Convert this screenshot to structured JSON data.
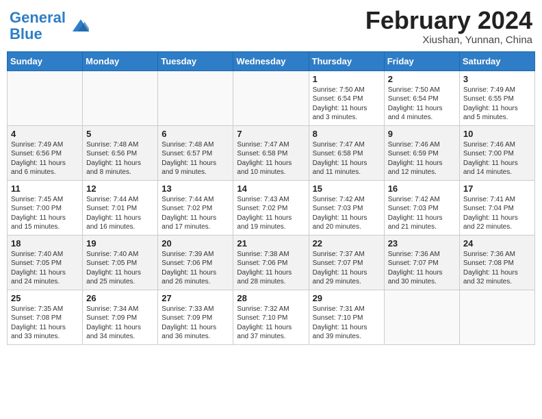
{
  "header": {
    "logo_line1": "General",
    "logo_line2": "Blue",
    "main_title": "February 2024",
    "subtitle": "Xiushan, Yunnan, China"
  },
  "days_of_week": [
    "Sunday",
    "Monday",
    "Tuesday",
    "Wednesday",
    "Thursday",
    "Friday",
    "Saturday"
  ],
  "weeks": [
    [
      {
        "day": "",
        "info": ""
      },
      {
        "day": "",
        "info": ""
      },
      {
        "day": "",
        "info": ""
      },
      {
        "day": "",
        "info": ""
      },
      {
        "day": "1",
        "info": "Sunrise: 7:50 AM\nSunset: 6:54 PM\nDaylight: 11 hours and 3 minutes."
      },
      {
        "day": "2",
        "info": "Sunrise: 7:50 AM\nSunset: 6:54 PM\nDaylight: 11 hours and 4 minutes."
      },
      {
        "day": "3",
        "info": "Sunrise: 7:49 AM\nSunset: 6:55 PM\nDaylight: 11 hours and 5 minutes."
      }
    ],
    [
      {
        "day": "4",
        "info": "Sunrise: 7:49 AM\nSunset: 6:56 PM\nDaylight: 11 hours and 6 minutes."
      },
      {
        "day": "5",
        "info": "Sunrise: 7:48 AM\nSunset: 6:56 PM\nDaylight: 11 hours and 8 minutes."
      },
      {
        "day": "6",
        "info": "Sunrise: 7:48 AM\nSunset: 6:57 PM\nDaylight: 11 hours and 9 minutes."
      },
      {
        "day": "7",
        "info": "Sunrise: 7:47 AM\nSunset: 6:58 PM\nDaylight: 11 hours and 10 minutes."
      },
      {
        "day": "8",
        "info": "Sunrise: 7:47 AM\nSunset: 6:58 PM\nDaylight: 11 hours and 11 minutes."
      },
      {
        "day": "9",
        "info": "Sunrise: 7:46 AM\nSunset: 6:59 PM\nDaylight: 11 hours and 12 minutes."
      },
      {
        "day": "10",
        "info": "Sunrise: 7:46 AM\nSunset: 7:00 PM\nDaylight: 11 hours and 14 minutes."
      }
    ],
    [
      {
        "day": "11",
        "info": "Sunrise: 7:45 AM\nSunset: 7:00 PM\nDaylight: 11 hours and 15 minutes."
      },
      {
        "day": "12",
        "info": "Sunrise: 7:44 AM\nSunset: 7:01 PM\nDaylight: 11 hours and 16 minutes."
      },
      {
        "day": "13",
        "info": "Sunrise: 7:44 AM\nSunset: 7:02 PM\nDaylight: 11 hours and 17 minutes."
      },
      {
        "day": "14",
        "info": "Sunrise: 7:43 AM\nSunset: 7:02 PM\nDaylight: 11 hours and 19 minutes."
      },
      {
        "day": "15",
        "info": "Sunrise: 7:42 AM\nSunset: 7:03 PM\nDaylight: 11 hours and 20 minutes."
      },
      {
        "day": "16",
        "info": "Sunrise: 7:42 AM\nSunset: 7:03 PM\nDaylight: 11 hours and 21 minutes."
      },
      {
        "day": "17",
        "info": "Sunrise: 7:41 AM\nSunset: 7:04 PM\nDaylight: 11 hours and 22 minutes."
      }
    ],
    [
      {
        "day": "18",
        "info": "Sunrise: 7:40 AM\nSunset: 7:05 PM\nDaylight: 11 hours and 24 minutes."
      },
      {
        "day": "19",
        "info": "Sunrise: 7:40 AM\nSunset: 7:05 PM\nDaylight: 11 hours and 25 minutes."
      },
      {
        "day": "20",
        "info": "Sunrise: 7:39 AM\nSunset: 7:06 PM\nDaylight: 11 hours and 26 minutes."
      },
      {
        "day": "21",
        "info": "Sunrise: 7:38 AM\nSunset: 7:06 PM\nDaylight: 11 hours and 28 minutes."
      },
      {
        "day": "22",
        "info": "Sunrise: 7:37 AM\nSunset: 7:07 PM\nDaylight: 11 hours and 29 minutes."
      },
      {
        "day": "23",
        "info": "Sunrise: 7:36 AM\nSunset: 7:07 PM\nDaylight: 11 hours and 30 minutes."
      },
      {
        "day": "24",
        "info": "Sunrise: 7:36 AM\nSunset: 7:08 PM\nDaylight: 11 hours and 32 minutes."
      }
    ],
    [
      {
        "day": "25",
        "info": "Sunrise: 7:35 AM\nSunset: 7:08 PM\nDaylight: 11 hours and 33 minutes."
      },
      {
        "day": "26",
        "info": "Sunrise: 7:34 AM\nSunset: 7:09 PM\nDaylight: 11 hours and 34 minutes."
      },
      {
        "day": "27",
        "info": "Sunrise: 7:33 AM\nSunset: 7:09 PM\nDaylight: 11 hours and 36 minutes."
      },
      {
        "day": "28",
        "info": "Sunrise: 7:32 AM\nSunset: 7:10 PM\nDaylight: 11 hours and 37 minutes."
      },
      {
        "day": "29",
        "info": "Sunrise: 7:31 AM\nSunset: 7:10 PM\nDaylight: 11 hours and 39 minutes."
      },
      {
        "day": "",
        "info": ""
      },
      {
        "day": "",
        "info": ""
      }
    ]
  ]
}
